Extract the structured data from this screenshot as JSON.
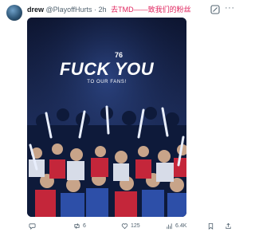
{
  "post": {
    "display_name": "drew",
    "handle": "@PlayoffHurts",
    "time": "· 2h",
    "text": "去TMD——致我们的粉丝"
  },
  "media": {
    "badge": "76",
    "title_word1": "FUCK",
    "title_word2": "YOU",
    "subtitle": "TO OUR FANS!"
  },
  "actions": {
    "replies": "",
    "reposts": "6",
    "likes": "125",
    "views": "6.4K"
  },
  "colors": {
    "accent_text": "#e0245e",
    "icon_gray": "#536471"
  },
  "icons": [
    "grok-icon",
    "more-icon",
    "reply-icon",
    "repost-icon",
    "like-icon",
    "views-icon",
    "bookmark-icon",
    "share-icon"
  ]
}
